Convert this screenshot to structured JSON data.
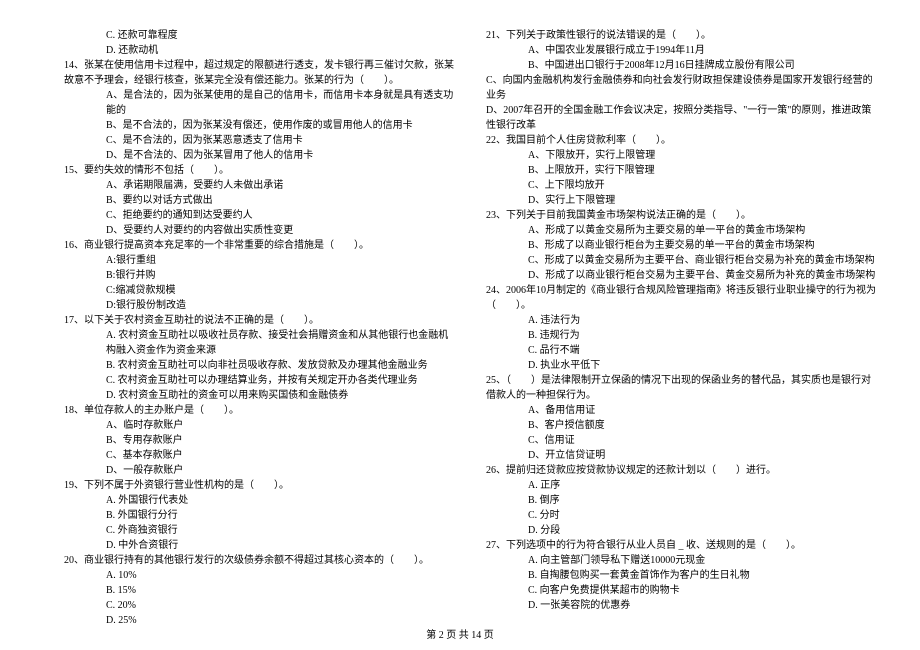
{
  "left": {
    "l0": "C. 还款可靠程度",
    "l1": "D. 还款动机",
    "q14": "14、张某在使用信用卡过程中，超过规定的限额进行透支，发卡银行再三催讨欠款，张某故意不予理会，经银行核查，张某完全没有偿还能力。张某的行为（　　）。",
    "q14a": "A、是合法的，因为张某使用的是自己的信用卡，而信用卡本身就是具有透支功能的",
    "q14b": "B、是不合法的，因为张某没有偿还，使用作废的或冒用他人的信用卡",
    "q14c": "C、是不合法的，因为张某恶意透支了信用卡",
    "q14d": "D、是不合法的、因为张某冒用了他人的信用卡",
    "q15": "15、要约失效的情形不包括（　　）。",
    "q15a": "A、承诺期限届满，受要约人未做出承诺",
    "q15b": "B、要约以对话方式做出",
    "q15c": "C、拒绝要约的通知到达受要约人",
    "q15d": "D、受要约人对要约的内容做出实质性变更",
    "q16": "16、商业银行提高资本充足率的一个非常重要的综合措施是（　　）。",
    "q16a": "A:银行重组",
    "q16b": "B:银行并购",
    "q16c": "C:缩减贷款规模",
    "q16d": "D:银行股份制改造",
    "q17": "17、以下关于农村资金互助社的说法不正确的是（　　）。",
    "q17a": "A. 农村资金互助社以吸收社员存款、接受社会捐赠资金和从其他银行也金融机构融入资金作为资金来源",
    "q17b": "B. 农村资金互助社可以向非社员吸收存款、发放贷款及办理其他金融业务",
    "q17c": "C. 农村资金互助社可以办理结算业务，并按有关规定开办各类代理业务",
    "q17d": "D. 农村资金互助社的资金可以用来购买国债和金融债券",
    "q18": "18、单位存款人的主办账户是（　　）。",
    "q18a": "A、临时存款账户",
    "q18b": "B、专用存款账户",
    "q18c": "C、基本存款账户",
    "q18d": "D、一般存款账户",
    "q19": "19、下列不属于外资银行营业性机构的是（　　）。",
    "q19a": "A. 外国银行代表处",
    "q19b": "B. 外国银行分行",
    "q19c": "C. 外商独资银行",
    "q19d": "D. 中外合资银行",
    "q20": "20、商业银行持有的其他银行发行的次级债券余额不得超过其核心资本的（　　）。",
    "q20a": "A. 10%",
    "q20b": "B. 15%",
    "q20c": "C. 20%",
    "q20d": "D. 25%"
  },
  "right": {
    "q21": "21、下列关于政策性银行的说法错误的是（　　）。",
    "q21a": "A、中国农业发展银行成立于1994年11月",
    "q21b": "B、中国进出口银行于2008年12月16日挂牌成立股份有限公司",
    "q21c": "C、向国内金融机构发行金融债券和向社会发行财政担保建设债券是国家开发银行经营的业务",
    "q21d": "D、2007年召开的全国金融工作会议决定，按照分类指导、\"一行一策\"的原则，推进政策性银行改革",
    "q22": "22、我国目前个人住房贷款利率（　　）。",
    "q22a": "A、下限放开，实行上限管理",
    "q22b": "B、上限放开，实行下限管理",
    "q22c": "C、上下限均放开",
    "q22d": "D、实行上下限管理",
    "q23": "23、下列关于目前我国黄金市场架构说法正确的是（　　）。",
    "q23a": "A、形成了以黄金交易所为主要交易的单一平台的黄金市场架构",
    "q23b": "B、形成了以商业银行柜台为主要交易的单一平台的黄金市场架构",
    "q23c": "C、形成了以黄金交易所为主要平台、商业银行柜台交易为补充的黄金市场架构",
    "q23d": "D、形成了以商业银行柜台交易为主要平台、黄金交易所为补充的黄金市场架构",
    "q24": "24、2006年10月制定的《商业银行合规风险管理指南》将违反银行业职业操守的行为视为（　　）。",
    "q24a": "A. 违法行为",
    "q24b": "B. 违规行为",
    "q24c": "C. 品行不端",
    "q24d": "D. 执业水平低下",
    "q25": "25、（　　）是法律限制开立保函的情况下出现的保函业务的替代品，其实质也是银行对借款人的一种担保行为。",
    "q25a": "A、备用信用证",
    "q25b": "B、客户授信额度",
    "q25c": "C、信用证",
    "q25d": "D、开立信贷证明",
    "q26": "26、提前归还贷款应按贷款协议规定的还款计划以（　　）进行。",
    "q26a": "A. 正序",
    "q26b": "B. 倒序",
    "q26c": "C. 分时",
    "q26d": "D. 分段",
    "q27": "27、下列选项中的行为符合银行从业人员自 _ 收、送规则的是（　　）。",
    "q27a": "A. 向主管部门领导私下赠送10000元现金",
    "q27b": "B. 自掏腰包购买一套黄金首饰作为客户的生日礼物",
    "q27c": "C. 向客户免费提供某超市的购物卡",
    "q27d": "D. 一张美容院的优惠券"
  },
  "footer": "第 2 页 共 14 页"
}
